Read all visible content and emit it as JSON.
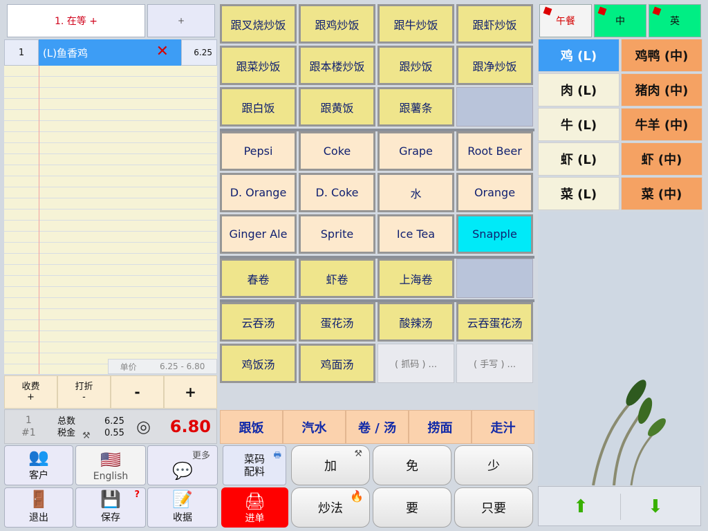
{
  "order": {
    "tab_label": "1. 在等  +",
    "new_tab_label": "+",
    "items": [
      {
        "qty": "1",
        "name": "(L)鱼香鸡",
        "price": "6.25"
      }
    ],
    "unit_price_label": "单价",
    "unit_price_range": "6.25  -  6.80"
  },
  "actions": {
    "charge_top": "收费",
    "charge_bottom": "+",
    "discount_top": "打折",
    "discount_bottom": "-",
    "minus": "-",
    "plus": "+"
  },
  "totals": {
    "seat_count": "1",
    "seat_no": "#1",
    "subtotal_label": "总数",
    "tax_label": "税金",
    "subtotal": "6.25",
    "tax": "0.55",
    "grand_total": "6.80"
  },
  "left_tiles": {
    "customer": "客户",
    "language": "English",
    "more": "更多",
    "exit": "退出",
    "save": "保存",
    "receipt": "收据"
  },
  "menu": {
    "rice": [
      "跟叉烧炒饭",
      "跟鸡炒饭",
      "跟牛炒饭",
      "跟虾炒饭",
      "跟菜炒饭",
      "跟本楼炒饭",
      "跟炒饭",
      "跟净炒饭",
      "跟白饭",
      "跟黄饭",
      "跟薯条"
    ],
    "drinks": [
      "Pepsi",
      "Coke",
      "Grape",
      "Root Beer",
      "D. Orange",
      "D. Coke",
      "水",
      "Orange",
      "Ginger Ale",
      "Sprite",
      "Ice Tea",
      "Snapple"
    ],
    "rolls": [
      "春卷",
      "虾卷",
      "上海卷"
    ],
    "soups": [
      "云吞汤",
      "蛋花汤",
      "酸辣汤",
      "云吞蛋花汤",
      "鸡饭汤",
      "鸡面汤"
    ],
    "special": [
      "( 抓码 ) ...",
      "( 手写 ) ..."
    ],
    "categories": [
      "跟饭",
      "汽水",
      "卷 / 汤",
      "捞面",
      "走汁"
    ]
  },
  "modifiers": {
    "dish_code_1": "菜码",
    "dish_code_2": "配料",
    "send": "进单",
    "add": "加",
    "free": "免",
    "less": "少",
    "cook_method": "炒法",
    "want": "要",
    "only": "只要"
  },
  "right": {
    "tabs": [
      "午餐",
      "中",
      "英"
    ],
    "proteins": [
      [
        "鸡 (L)",
        "鸡鸭 (中)"
      ],
      [
        "肉 (L)",
        "猪肉 (中)"
      ],
      [
        "牛 (L)",
        "牛羊 (中)"
      ],
      [
        "虾 (L)",
        "虾 (中)"
      ],
      [
        "菜 (L)",
        "菜 (中)"
      ]
    ]
  },
  "colors": {
    "accent_blue": "#3d9df5",
    "total_red": "#e00000",
    "send_red": "#ff0000",
    "tab_green": "#00ee84"
  }
}
